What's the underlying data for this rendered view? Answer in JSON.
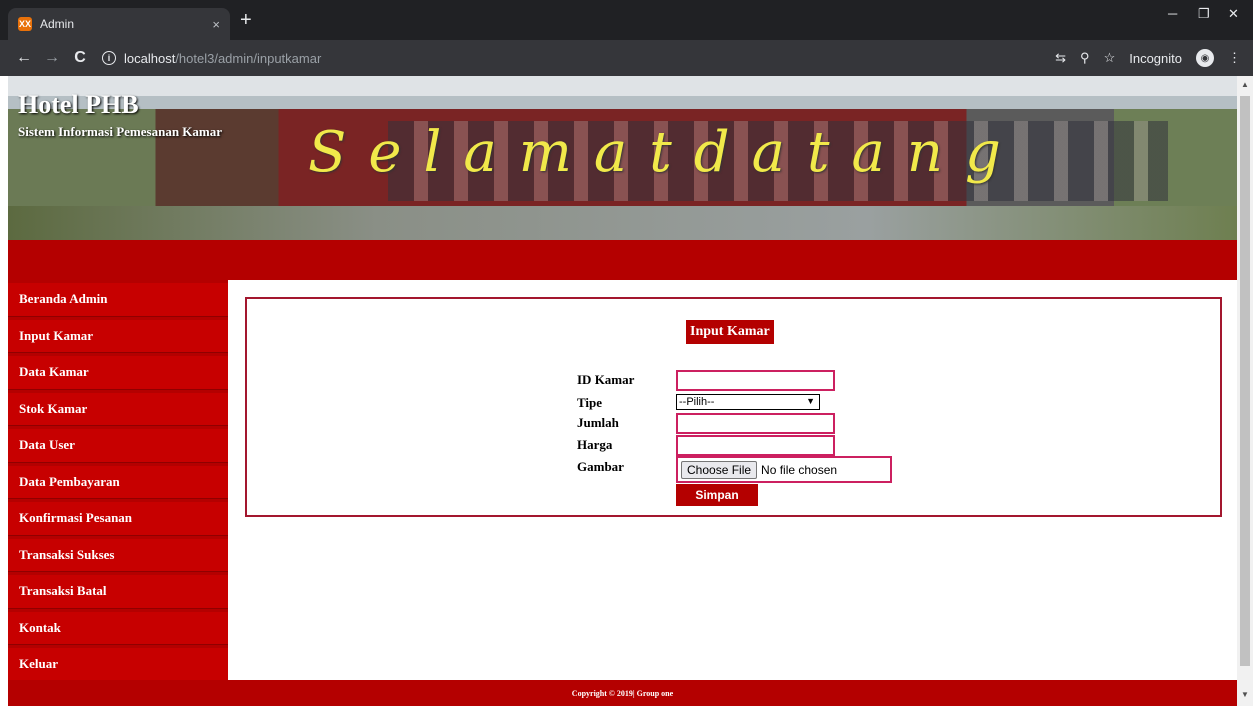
{
  "browser": {
    "tab_title": "Admin",
    "tab_icon": "XX",
    "close_tab": "×",
    "new_tab": "+",
    "url_host": "localhost",
    "url_path": "/hotel3/admin/inputkamar",
    "incognito_label": "Incognito",
    "minimize": "─",
    "restore": "❐",
    "close": "✕",
    "back": "←",
    "forward": "→",
    "reload": "C",
    "info": "i",
    "translate_icon": "⇆",
    "zoom_icon": "⚲",
    "star_icon": "☆",
    "menu_icon": "⋮"
  },
  "header": {
    "site_title": "Hotel PHB",
    "subtitle": "Sistem Informasi Pemesanan Kamar",
    "welcome": "Selamatdatang"
  },
  "sidebar": {
    "items": [
      {
        "label": "Beranda Admin"
      },
      {
        "label": "Input Kamar"
      },
      {
        "label": "Data Kamar"
      },
      {
        "label": "Stok Kamar"
      },
      {
        "label": "Data User"
      },
      {
        "label": "Data Pembayaran"
      },
      {
        "label": "Konfirmasi Pesanan"
      },
      {
        "label": "Transaksi Sukses"
      },
      {
        "label": "Transaksi Batal"
      },
      {
        "label": "Kontak"
      },
      {
        "label": "Keluar"
      }
    ]
  },
  "form": {
    "title": "Input Kamar",
    "id_label": "ID Kamar",
    "id_value": "",
    "tipe_label": "Tipe",
    "tipe_selected": "--Pilih--",
    "jumlah_label": "Jumlah",
    "jumlah_value": "",
    "harga_label": "Harga",
    "harga_value": "",
    "gambar_label": "Gambar",
    "choose_file": "Choose File",
    "file_status": "No file chosen",
    "submit": "Simpan"
  },
  "footer": {
    "text": "Copyright © 2019| Group one"
  },
  "colors": {
    "brand_red": "#b40000",
    "input_border": "#cc2060",
    "panel_border": "#a3172e"
  }
}
